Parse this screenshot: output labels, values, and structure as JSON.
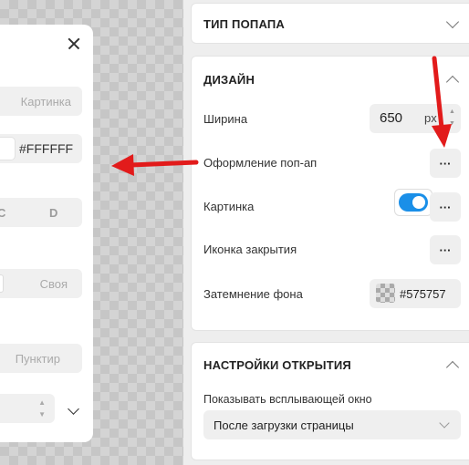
{
  "popup_preview": {
    "image_option": "Картинка",
    "color_value": "#FFFFFF",
    "option_c": "C",
    "option_d": "D",
    "own_option": "Своя",
    "dashed_option": "Пунктир"
  },
  "sections": {
    "popup_type": {
      "title": "ТИП ПОПАПА"
    },
    "design": {
      "title": "ДИЗАЙН",
      "width_label": "Ширина",
      "width_value": "650",
      "width_unit": "px",
      "popup_style_label": "Оформление поп-ап",
      "image_label": "Картинка",
      "image_enabled": true,
      "close_icon_label": "Иконка закрытия",
      "overlay_label": "Затемнение фона",
      "overlay_color": "#575757"
    },
    "open_settings": {
      "title": "НАСТРОЙКИ ОТКРЫТИЯ",
      "show_label": "Показывать всплывающей окно",
      "show_value": "После загрузки страницы"
    }
  },
  "dots": "···",
  "colors": {
    "accent": "#1a8fe8",
    "arrow": "#e21b1b"
  }
}
